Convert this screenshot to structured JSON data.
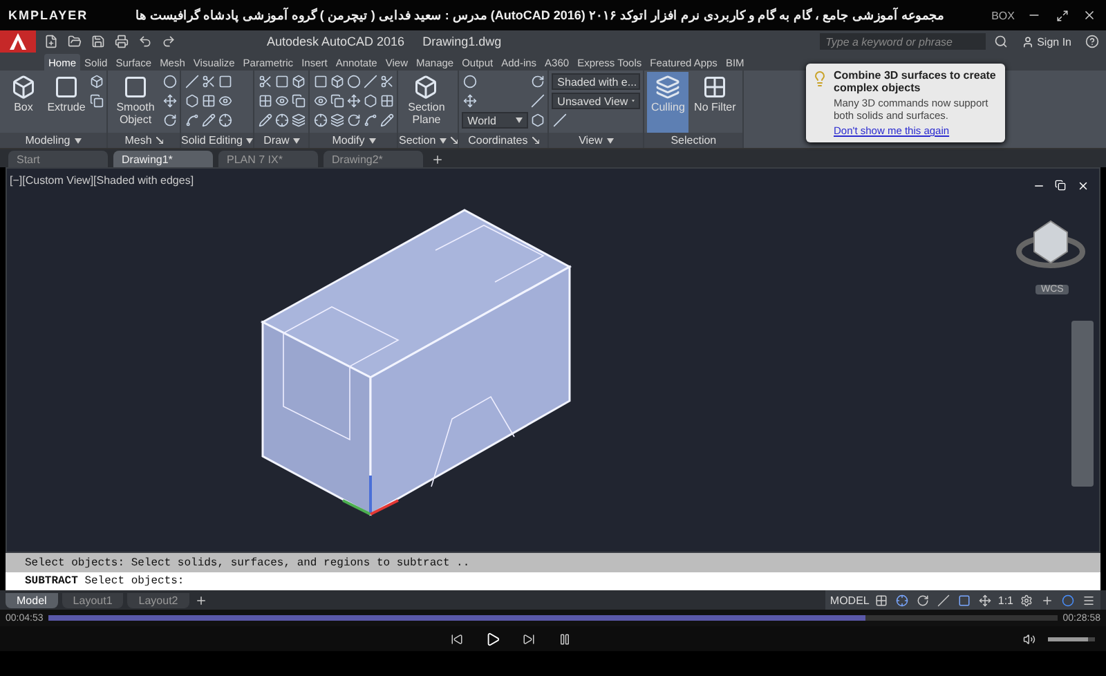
{
  "player": {
    "brand": "KMPLAYER",
    "title": "مجموعه آموزشی جامع ، گام به گام و کاربردی نرم افزار  اتوکد ۲۰۱۶ (AutoCAD 2016)  مدرس : سعید فدایی ( تیچرمن ) گروه آموزشی پادشاه گرافیست ها",
    "badge": "BOX",
    "elapsed": "00:04:53",
    "total": "00:28:58",
    "seek": {
      "level": 0.81
    },
    "volume": {
      "level": 0.85
    }
  },
  "app": {
    "title": "Autodesk AutoCAD 2016",
    "file": "Drawing1.dwg",
    "search_placeholder": "Type a keyword or phrase",
    "sign_in": "Sign In"
  },
  "ribbon_tabs": [
    {
      "label": "Home",
      "selected": true
    },
    {
      "label": "Solid",
      "selected": false
    },
    {
      "label": "Surface",
      "selected": false
    },
    {
      "label": "Mesh",
      "selected": false
    },
    {
      "label": "Visualize",
      "selected": false
    },
    {
      "label": "Parametric",
      "selected": false
    },
    {
      "label": "Insert",
      "selected": false
    },
    {
      "label": "Annotate",
      "selected": false
    },
    {
      "label": "View",
      "selected": false
    },
    {
      "label": "Manage",
      "selected": false
    },
    {
      "label": "Output",
      "selected": false
    },
    {
      "label": "Add-ins",
      "selected": false
    },
    {
      "label": "A360",
      "selected": false
    },
    {
      "label": "Express Tools",
      "selected": false
    },
    {
      "label": "Featured Apps",
      "selected": false
    },
    {
      "label": "BIM",
      "selected": false
    }
  ],
  "panels": [
    {
      "title": "Modeling",
      "menu": true,
      "launcher": false,
      "tools": [
        {
          "kind": "large",
          "label": "Box",
          "on": false
        },
        {
          "kind": "large",
          "label": "Extrude",
          "on": false
        },
        {
          "kind": "icon"
        },
        {
          "kind": "icon"
        }
      ]
    },
    {
      "title": "Mesh",
      "menu": false,
      "launcher": true,
      "tools": [
        {
          "kind": "large",
          "label": "Smooth Object",
          "on": false
        },
        {
          "kind": "icon"
        },
        {
          "kind": "icon"
        },
        {
          "kind": "icon"
        }
      ]
    },
    {
      "title": "Solid Editing",
      "menu": true,
      "launcher": false,
      "tools": [
        {
          "kind": "icon"
        },
        {
          "kind": "icon"
        },
        {
          "kind": "icon"
        },
        {
          "kind": "icon"
        },
        {
          "kind": "icon"
        },
        {
          "kind": "icon"
        },
        {
          "kind": "icon"
        },
        {
          "kind": "icon"
        },
        {
          "kind": "icon"
        }
      ]
    },
    {
      "title": "Draw",
      "menu": true,
      "launcher": false,
      "tools": [
        {
          "kind": "icon"
        },
        {
          "kind": "icon"
        },
        {
          "kind": "icon"
        },
        {
          "kind": "icon"
        },
        {
          "kind": "icon"
        },
        {
          "kind": "icon"
        },
        {
          "kind": "icon"
        },
        {
          "kind": "icon"
        },
        {
          "kind": "icon"
        }
      ]
    },
    {
      "title": "Modify",
      "menu": true,
      "launcher": false,
      "tools": [
        {
          "kind": "icon"
        },
        {
          "kind": "icon"
        },
        {
          "kind": "icon"
        },
        {
          "kind": "icon"
        },
        {
          "kind": "icon"
        },
        {
          "kind": "icon"
        },
        {
          "kind": "icon"
        },
        {
          "kind": "icon"
        },
        {
          "kind": "icon"
        },
        {
          "kind": "icon"
        },
        {
          "kind": "icon"
        },
        {
          "kind": "icon"
        },
        {
          "kind": "icon"
        },
        {
          "kind": "icon"
        },
        {
          "kind": "icon"
        }
      ]
    },
    {
      "title": "Section",
      "menu": true,
      "launcher": true,
      "tools": [
        {
          "kind": "large",
          "label": "Section Plane",
          "on": false
        }
      ]
    },
    {
      "title": "Coordinates",
      "menu": false,
      "launcher": true,
      "tools": [
        {
          "kind": "icon"
        },
        {
          "kind": "icon"
        },
        {
          "kind": "dropdown",
          "label": "World"
        },
        {
          "kind": "icon"
        },
        {
          "kind": "icon"
        },
        {
          "kind": "icon"
        }
      ]
    },
    {
      "title": "View",
      "menu": true,
      "launcher": false,
      "tools": [
        {
          "kind": "dropdown",
          "label": "Shaded with e..."
        },
        {
          "kind": "dropdown",
          "label": "Unsaved View"
        },
        {
          "kind": "icon"
        }
      ]
    },
    {
      "title": "Selection",
      "menu": false,
      "launcher": false,
      "tools": [
        {
          "kind": "large",
          "label": "Culling",
          "on": true
        },
        {
          "kind": "large",
          "label": "No Filter",
          "on": false
        }
      ]
    }
  ],
  "file_tabs": [
    {
      "label": "Start",
      "selected": false
    },
    {
      "label": "Drawing1*",
      "selected": true
    },
    {
      "label": "PLAN 7 IX*",
      "selected": false
    },
    {
      "label": "Drawing2*",
      "selected": false
    }
  ],
  "viewport": {
    "label": "[−][Custom View][Shaded with edges]",
    "wcs": "WCS"
  },
  "tooltip": {
    "title": "Combine 3D surfaces to create complex objects",
    "body": "Many 3D commands now support both solids and surfaces.",
    "link": "Don't show me this again"
  },
  "command": {
    "history": "Select objects:  Select solids, surfaces, and regions to subtract ..",
    "prompt": "**SUBTRACT** Select objects:"
  },
  "layout_tabs": [
    {
      "label": "Model",
      "selected": true
    },
    {
      "label": "Layout1",
      "selected": false
    },
    {
      "label": "Layout2",
      "selected": false
    }
  ],
  "status": {
    "mode": "MODEL",
    "scale": "1:1"
  }
}
